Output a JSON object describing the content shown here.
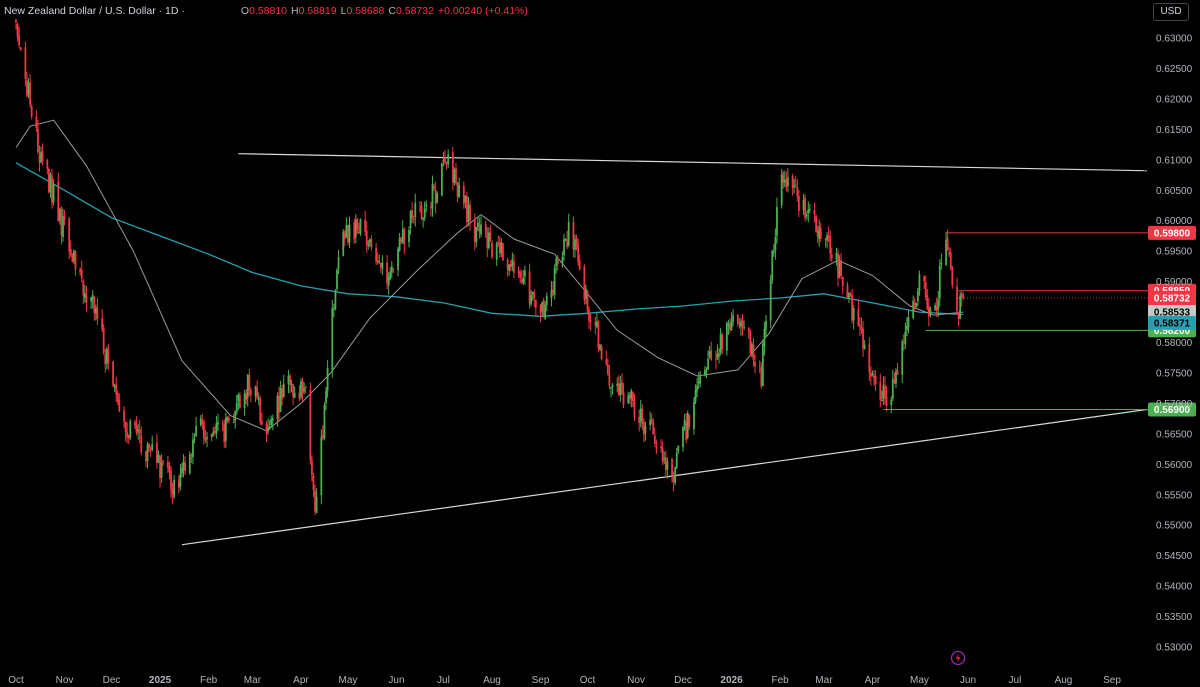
{
  "header": {
    "symbol": "New Zealand Dollar / U.S. Dollar · 1D ·",
    "open_label": "O",
    "open": "0.58810",
    "high_label": "H",
    "high": "0.58819",
    "low_label": "L",
    "low": "0.58688",
    "close_label": "C",
    "close": "0.58732",
    "change": "+0.00240 (+0.41%)",
    "currency": "USD"
  },
  "icons": {
    "lightning": "lightning-icon"
  },
  "colors": {
    "background": "#000000",
    "up": "#4caf50",
    "down": "#f23645",
    "ma_long": "#26a0b0",
    "ma_short": "#9a9a9a",
    "trendline": "#d9d9d9",
    "axis_text": "#b2b5be"
  },
  "chart_data": {
    "type": "candlestick",
    "x_ticks": [
      "Oct",
      "Nov",
      "Dec",
      "2025",
      "Feb",
      "Mar",
      "Apr",
      "May",
      "Jun",
      "Jul",
      "Aug",
      "Sep",
      "Oct",
      "Nov",
      "Dec",
      "2026",
      "Feb",
      "Mar",
      "Apr",
      "May",
      "Jun",
      "Jul",
      "Aug",
      "Sep"
    ],
    "y_ticks": [
      "0.63000",
      "0.62500",
      "0.62000",
      "0.61500",
      "0.61000",
      "0.60500",
      "0.60000",
      "0.59500",
      "0.59000",
      "0.58500",
      "0.58000",
      "0.57500",
      "0.57000",
      "0.56500",
      "0.56000",
      "0.55500",
      "0.55000",
      "0.54500",
      "0.54000",
      "0.53500",
      "0.53000"
    ],
    "ylim": [
      0.5292,
      0.6346
    ],
    "grid": false,
    "anchors": [
      [
        "2024-10-01",
        0.633
      ],
      [
        "2024-10-15",
        0.612
      ],
      [
        "2024-11-01",
        0.598
      ],
      [
        "2024-11-20",
        0.585
      ],
      [
        "2024-12-10",
        0.566
      ],
      [
        "2025-01-01",
        0.56
      ],
      [
        "2025-01-10",
        0.556
      ],
      [
        "2025-01-25",
        0.566
      ],
      [
        "2025-02-10",
        0.565
      ],
      [
        "2025-03-01",
        0.574
      ],
      [
        "2025-03-10",
        0.565
      ],
      [
        "2025-03-25",
        0.574
      ],
      [
        "2025-04-05",
        0.57
      ],
      [
        "2025-04-10",
        0.552
      ],
      [
        "2025-04-25",
        0.596
      ],
      [
        "2025-05-10",
        0.6
      ],
      [
        "2025-05-25",
        0.59
      ],
      [
        "2025-06-10",
        0.601
      ],
      [
        "2025-06-25",
        0.604
      ],
      [
        "2025-07-03",
        0.611
      ],
      [
        "2025-07-20",
        0.599
      ],
      [
        "2025-08-01",
        0.596
      ],
      [
        "2025-08-20",
        0.592
      ],
      [
        "2025-09-01",
        0.584
      ],
      [
        "2025-09-20",
        0.599
      ],
      [
        "2025-10-01",
        0.586
      ],
      [
        "2025-10-15",
        0.575
      ],
      [
        "2025-11-01",
        0.569
      ],
      [
        "2025-11-25",
        0.559
      ],
      [
        "2025-12-05",
        0.568
      ],
      [
        "2025-12-20",
        0.578
      ],
      [
        "2026-01-05",
        0.584
      ],
      [
        "2026-01-20",
        0.575
      ],
      [
        "2026-02-01",
        0.607
      ],
      [
        "2026-02-15",
        0.603
      ],
      [
        "2026-03-01",
        0.598
      ],
      [
        "2026-03-20",
        0.585
      ],
      [
        "2026-04-05",
        0.57
      ],
      [
        "2026-04-15",
        0.573
      ],
      [
        "2026-05-01",
        0.59
      ],
      [
        "2026-05-10",
        0.584
      ],
      [
        "2026-05-18",
        0.597
      ],
      [
        "2026-05-25",
        0.585
      ],
      [
        "2026-05-29",
        0.5873
      ]
    ],
    "ma_long": [
      [
        "2024-10-01",
        0.6095
      ],
      [
        "2024-11-01",
        0.605
      ],
      [
        "2024-12-01",
        0.6005
      ],
      [
        "2025-01-01",
        0.5975
      ],
      [
        "2025-02-01",
        0.5945
      ],
      [
        "2025-03-01",
        0.5915
      ],
      [
        "2025-04-01",
        0.5893
      ],
      [
        "2025-05-01",
        0.588
      ],
      [
        "2025-06-01",
        0.5875
      ],
      [
        "2025-07-01",
        0.5865
      ],
      [
        "2025-08-01",
        0.5848
      ],
      [
        "2025-09-01",
        0.5843
      ],
      [
        "2025-10-01",
        0.5848
      ],
      [
        "2025-11-01",
        0.5855
      ],
      [
        "2025-12-01",
        0.586
      ],
      [
        "2026-01-01",
        0.5868
      ],
      [
        "2026-02-01",
        0.5873
      ],
      [
        "2026-03-01",
        0.588
      ],
      [
        "2026-04-01",
        0.5865
      ],
      [
        "2026-05-01",
        0.585
      ],
      [
        "2026-05-29",
        0.5846
      ]
    ],
    "ma_short": [
      [
        "2024-10-01",
        0.612
      ],
      [
        "2024-10-10",
        0.6155
      ],
      [
        "2024-10-25",
        0.6165
      ],
      [
        "2024-11-15",
        0.609
      ],
      [
        "2024-12-15",
        0.595
      ],
      [
        "2025-01-15",
        0.577
      ],
      [
        "2025-02-15",
        0.568
      ],
      [
        "2025-03-10",
        0.5655
      ],
      [
        "2025-04-01",
        0.57
      ],
      [
        "2025-04-20",
        0.575
      ],
      [
        "2025-05-15",
        0.584
      ],
      [
        "2025-06-15",
        0.592
      ],
      [
        "2025-07-10",
        0.598
      ],
      [
        "2025-07-25",
        0.601
      ],
      [
        "2025-08-15",
        0.597
      ],
      [
        "2025-09-10",
        0.5945
      ],
      [
        "2025-10-01",
        0.588
      ],
      [
        "2025-10-20",
        0.582
      ],
      [
        "2025-11-15",
        0.5775
      ],
      [
        "2025-12-10",
        0.5745
      ],
      [
        "2026-01-05",
        0.5755
      ],
      [
        "2026-01-25",
        0.5815
      ],
      [
        "2026-02-15",
        0.5905
      ],
      [
        "2026-03-10",
        0.5935
      ],
      [
        "2026-04-01",
        0.591
      ],
      [
        "2026-04-25",
        0.586
      ],
      [
        "2026-05-10",
        0.5845
      ],
      [
        "2026-05-29",
        0.585
      ]
    ],
    "trendlines": [
      {
        "from": [
          "2025-02-20",
          0.611
        ],
        "to": [
          "2026-09-30",
          0.6082
        ]
      },
      {
        "from": [
          "2025-01-15",
          0.5468
        ],
        "to": [
          "2026-09-30",
          0.569
        ]
      }
    ],
    "levels": [
      {
        "value": 0.598,
        "label": "0.59800",
        "color": "#f23645",
        "from": "2026-05-18"
      },
      {
        "value": 0.5885,
        "label": "0.58850",
        "color": "#f23645",
        "from": "2026-05-25"
      },
      {
        "value": 0.582,
        "label": "0.58200",
        "color": "#4caf50",
        "from": "2026-05-05"
      },
      {
        "value": 0.569,
        "label": "0.56900",
        "color": "#4caf50",
        "from": "2026-04-08"
      }
    ],
    "price_tags": [
      {
        "value": 0.58732,
        "label": "0.58732",
        "countdown": "14:39:02",
        "color": "#f23645",
        "text": "#ffffff"
      },
      {
        "value": 0.58533,
        "label": "0.58533",
        "color": "#c8c8c8",
        "text": "#000000"
      },
      {
        "value": 0.58371,
        "label": "0.58371",
        "color": "#26a0b0",
        "text": "#000000"
      }
    ],
    "last_close": 0.58732
  }
}
